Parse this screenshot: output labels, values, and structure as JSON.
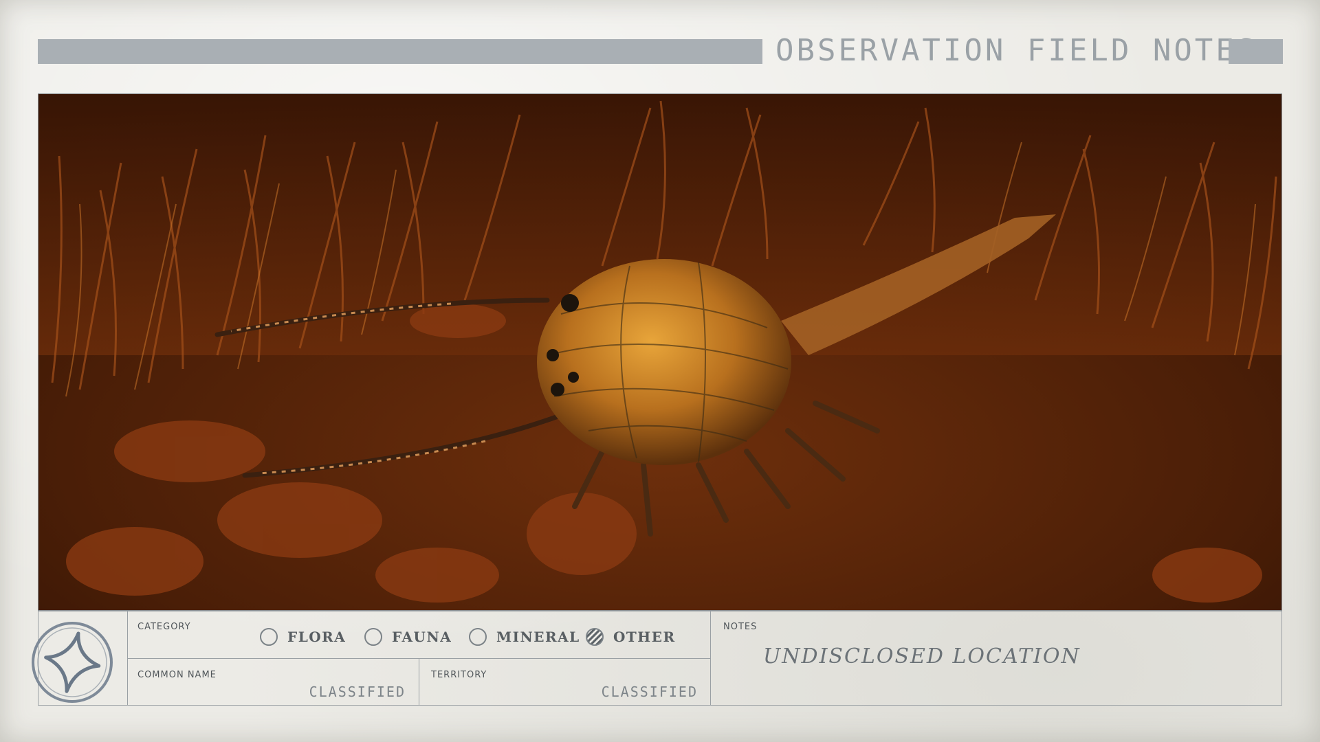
{
  "header": {
    "title": "OBSERVATION FIELD NOTES"
  },
  "photo": {
    "subject_icon": "alien-creature-photo"
  },
  "panel": {
    "emblem_icon": "compass-star-icon",
    "category": {
      "label": "CATEGORY",
      "options": [
        "FLORA",
        "FAUNA",
        "MINERAL",
        "OTHER"
      ],
      "selected": "OTHER"
    },
    "common_name": {
      "label": "COMMON NAME",
      "value": "CLASSIFIED"
    },
    "territory": {
      "label": "TERRITORY",
      "value": "CLASSIFIED"
    },
    "notes": {
      "label": "NOTES",
      "value": "UNDISCLOSED LOCATION"
    }
  },
  "colors": {
    "paper": "#ecebe6",
    "header_bar": "#a9afb4",
    "ink": "#585e62"
  }
}
